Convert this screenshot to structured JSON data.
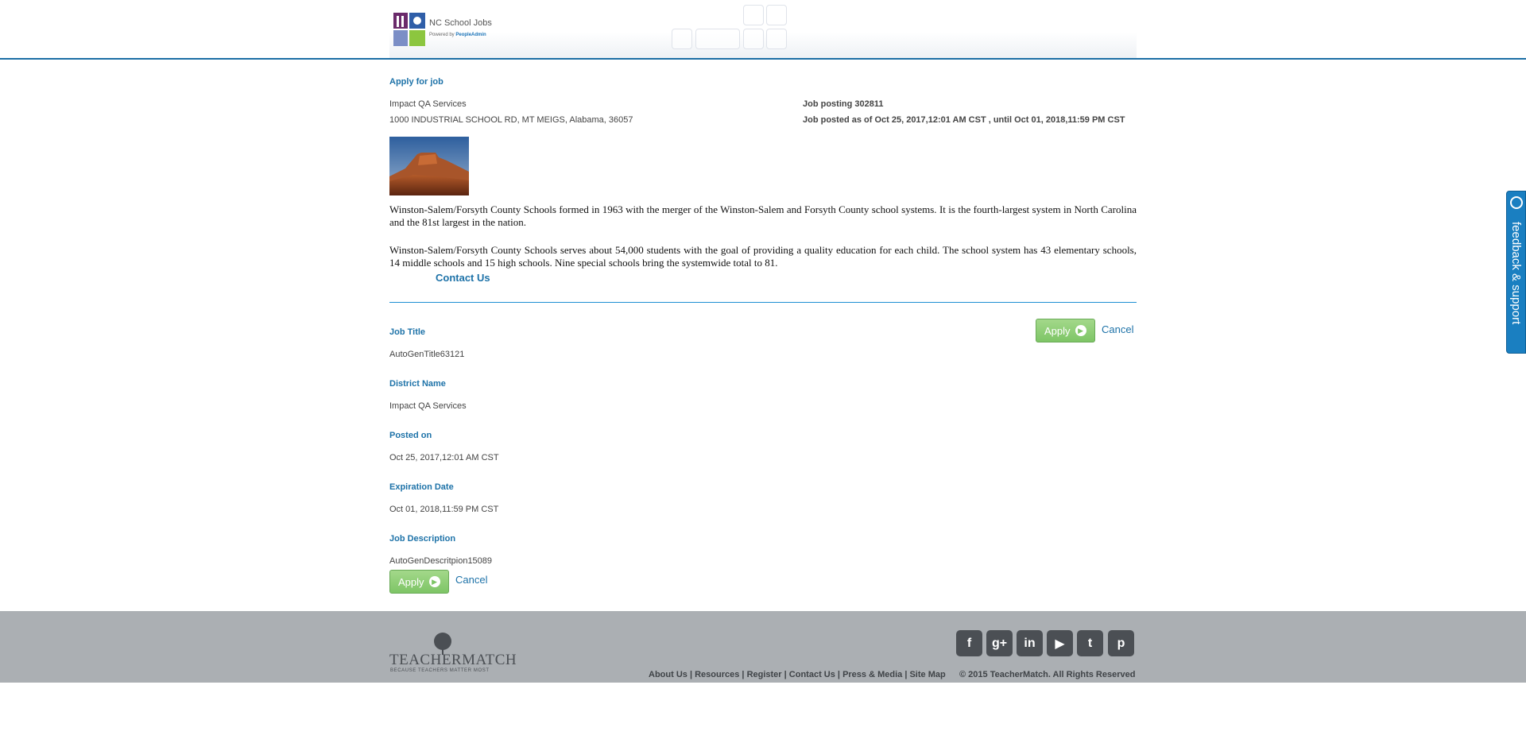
{
  "header": {
    "logo_title": "NC School Jobs",
    "logo_powered": "Powered by",
    "logo_brand": "PeopleAdmin"
  },
  "job_header": {
    "section_title": "Apply for job",
    "district": "Impact QA Services",
    "address": "1000 INDUSTRIAL SCHOOL RD, MT MEIGS, Alabama, 36057",
    "posting_id": "Job posting 302811",
    "posting_dates": "Job posted as of Oct 25, 2017,12:01 AM CST , until Oct 01, 2018,11:59 PM CST"
  },
  "description": {
    "para1": "Winston-Salem/Forsyth County Schools formed in 1963 with the merger of the Winston-Salem and Forsyth County school systems. It is the fourth-largest system in North Carolina and the 81st largest in the nation.",
    "para2": "Winston-Salem/Forsyth County Schools serves about 54,000 students with the goal of providing a quality education for each child. The school system has 43 elementary schools, 14 middle schools and 15 high schools. Nine special schools bring the systemwide total to 81.",
    "contact_link": "Contact Us"
  },
  "fields": [
    {
      "label": "Job Title",
      "value": "AutoGenTitle63121"
    },
    {
      "label": "District Name",
      "value": "Impact QA Services"
    },
    {
      "label": "Posted on",
      "value": "Oct 25, 2017,12:01 AM CST"
    },
    {
      "label": "Expiration Date",
      "value": "Oct 01, 2018,11:59 PM CST"
    },
    {
      "label": "Job Description",
      "value": "AutoGenDescritpion15089"
    }
  ],
  "actions": {
    "apply_label": "Apply",
    "cancel_label": "Cancel"
  },
  "footer": {
    "brand": "TEACHERMATCH",
    "tagline": "BECAUSE TEACHERS MATTER MOST",
    "social": [
      "facebook-icon",
      "google-plus-icon",
      "linkedin-icon",
      "youtube-icon",
      "twitter-icon",
      "pinterest-icon"
    ],
    "social_glyphs": [
      "f",
      "g+",
      "in",
      "▶",
      "t",
      "p"
    ],
    "links": [
      "About Us",
      "Resources",
      "Register",
      "Contact Us",
      "Press & Media",
      "Site Map"
    ],
    "copyright": "© 2015 TeacherMatch. All Rights Reserved"
  },
  "feedback_tab": {
    "label": "feedback & support"
  },
  "colors": {
    "accent": "#1d72a8",
    "apply_green": "#7ec566",
    "footer_bg": "#abafb3"
  }
}
